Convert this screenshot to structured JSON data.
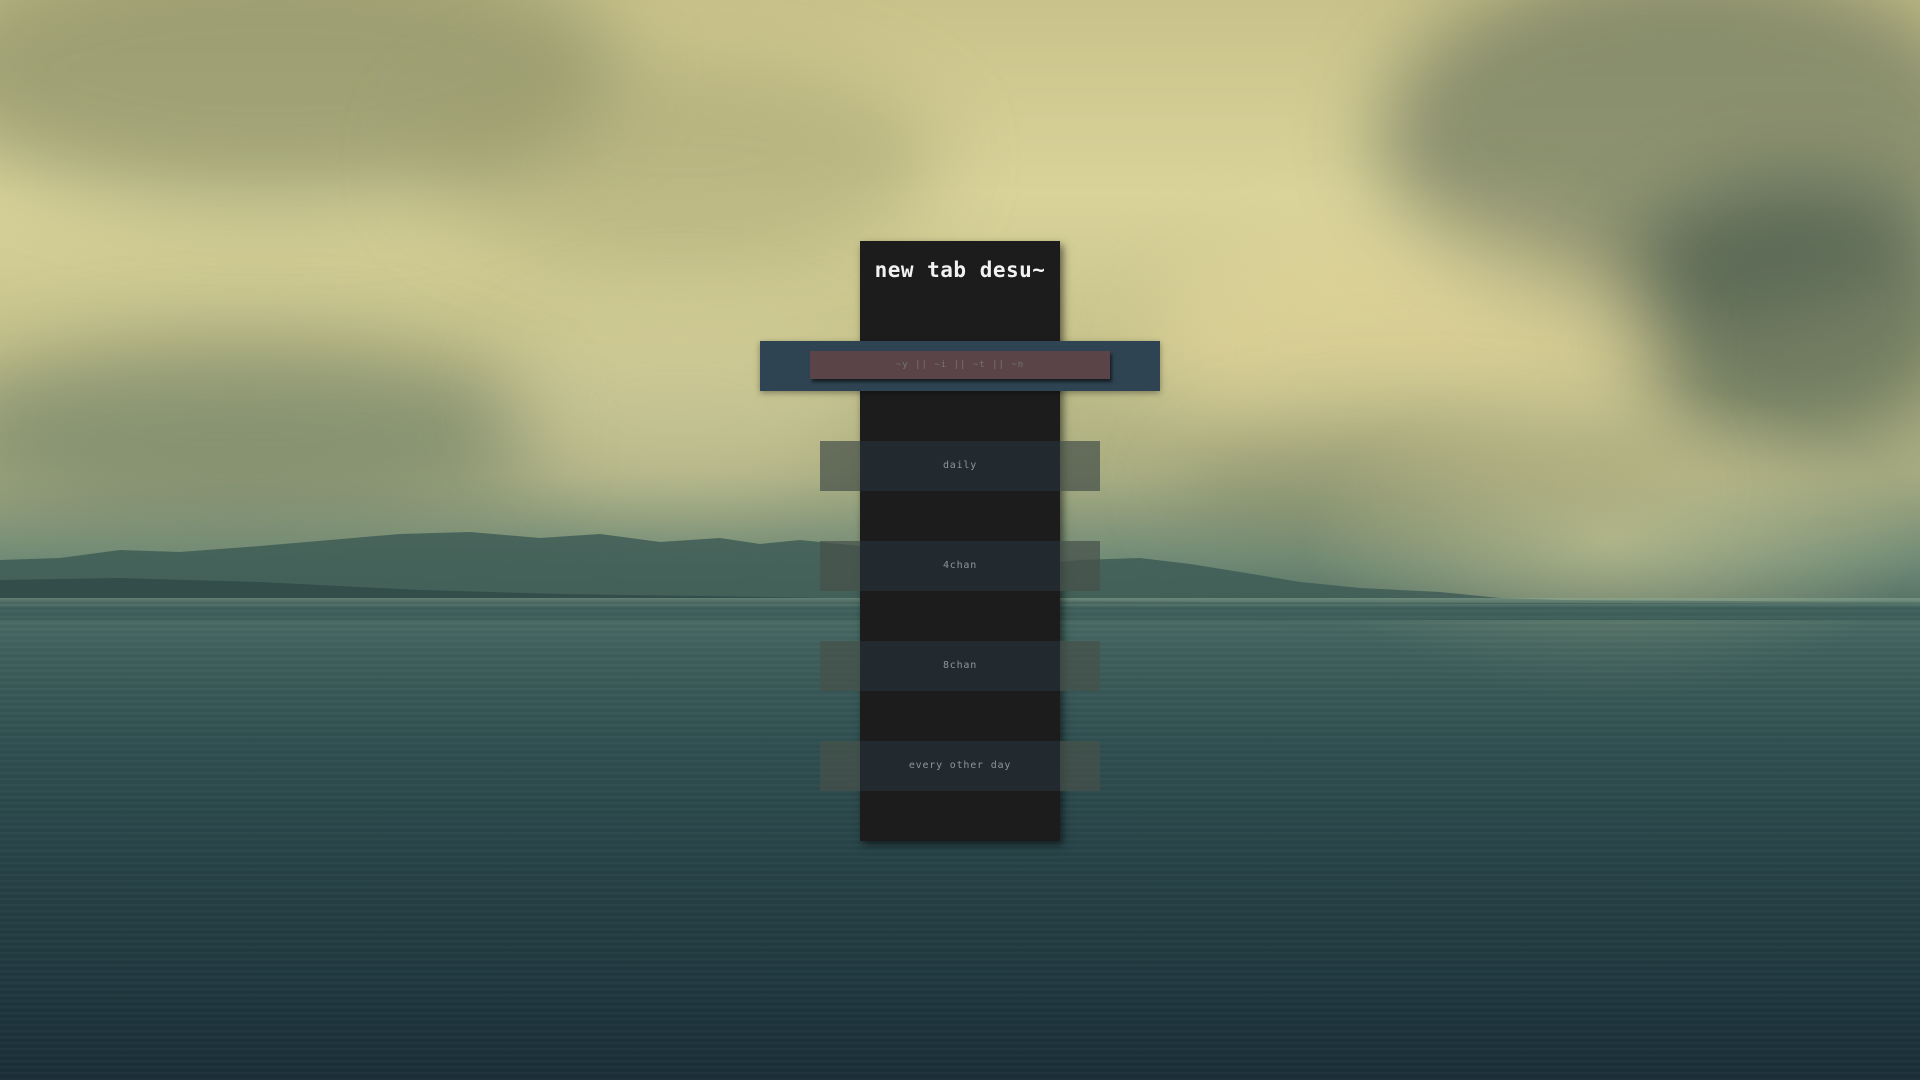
{
  "page": {
    "title": "new tab desu~"
  },
  "search": {
    "placeholder": "~y || ~i || ~t || ~n"
  },
  "links": [
    {
      "label": "daily"
    },
    {
      "label": "4chan"
    },
    {
      "label": "8chan"
    },
    {
      "label": "every other day"
    }
  ],
  "colors": {
    "panel": "#1c1c1c",
    "search_band": "#2f4452",
    "search_box": "#5b4448",
    "link_bg": "#222a30",
    "title_text": "#f2f2f2"
  }
}
